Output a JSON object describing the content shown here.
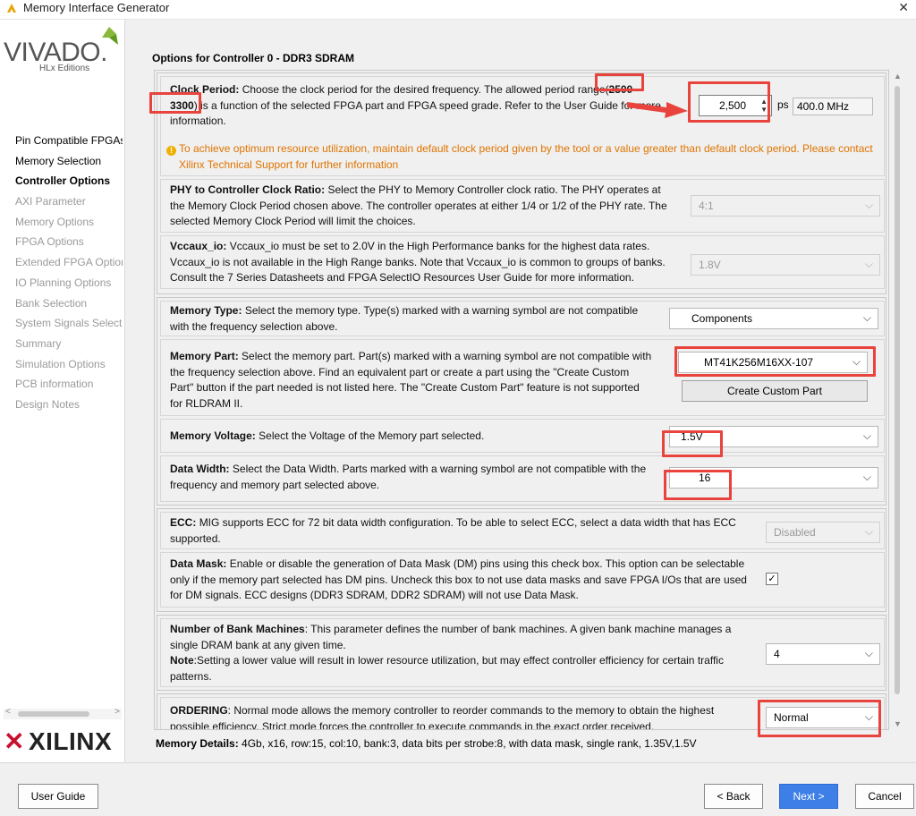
{
  "window": {
    "title": "Memory Interface Generator",
    "close_label": "✕"
  },
  "brand": {
    "vivado": "VIVADO.",
    "hlx": "HLx Editions",
    "xilinx": "XILINX"
  },
  "nav": {
    "items": [
      {
        "label": "Pin Compatible FPGAs",
        "state": "enabled"
      },
      {
        "label": "Memory Selection",
        "state": "enabled"
      },
      {
        "label": "Controller Options",
        "state": "current"
      },
      {
        "label": "AXI Parameter",
        "state": "disabled"
      },
      {
        "label": "Memory Options",
        "state": "disabled"
      },
      {
        "label": "FPGA Options",
        "state": "disabled"
      },
      {
        "label": "Extended FPGA Options",
        "state": "disabled"
      },
      {
        "label": "IO Planning Options",
        "state": "disabled"
      },
      {
        "label": "Bank Selection",
        "state": "disabled"
      },
      {
        "label": "System Signals Selection",
        "state": "disabled"
      },
      {
        "label": "Summary",
        "state": "disabled"
      },
      {
        "label": "Simulation Options",
        "state": "disabled"
      },
      {
        "label": "PCB information",
        "state": "disabled"
      },
      {
        "label": "Design Notes",
        "state": "disabled"
      }
    ]
  },
  "main": {
    "heading": "Options for Controller 0 - DDR3 SDRAM",
    "clock": {
      "title": "Clock Period:",
      "line1": "Choose the clock period for the desired frequency. The allowed period range(",
      "range_a": "2500 -",
      "range_b": "3300",
      "line2": ") is a function of the selected FPGA part and FPGA speed grade. Refer to the User Guide for more",
      "line3": "information.",
      "value": "2,500",
      "unit": "ps",
      "freq": "400.0 MHz",
      "warning_line1": "To achieve optimum resource utilization, maintain default clock period given by the tool or a value greater than default clock period. Please contact",
      "warning_line2": "Xilinx Technical Support for further information"
    },
    "phy": {
      "title": "PHY to Controller Clock Ratio:",
      "line1": "Select the PHY to Memory Controller clock ratio. The PHY operates at",
      "line2": "the Memory Clock Period chosen above. The controller operates at either 1/4 or 1/2 of the PHY rate. The",
      "line3": "selected Memory Clock Period will limit the choices.",
      "value": "4:1"
    },
    "vccaux": {
      "title": "Vccaux_io:",
      "line1": "Vccaux_io must be set to 2.0V in the High Performance banks for the highest data rates.",
      "line2": "Vccaux_io is not available in the High Range banks. Note that Vccaux_io is common to groups of banks.",
      "line3": "Consult the 7 Series Datasheets and FPGA SelectIO Resources User Guide for more information.",
      "value": "1.8V"
    },
    "memtype": {
      "title": "Memory Type:",
      "line1": "Select the memory type. Type(s) marked with a warning symbol are not compatible",
      "line2": "with the frequency selection above.",
      "value": "Components"
    },
    "mempart": {
      "title": "Memory Part:",
      "line1": "Select the memory part. Part(s) marked with a warning symbol are not compatible with",
      "line2": "the frequency selection above. Find an equivalent part or create a part using the \"Create Custom",
      "line3": "Part\" button if the part needed is not listed here. The \"Create Custom Part\" feature is not supported",
      "line4": "for RLDRAM II.",
      "value": "MT41K256M16XX-107",
      "custom_button": "Create Custom Part"
    },
    "voltage": {
      "title": "Memory Voltage:",
      "line1": "Select the Voltage of the Memory part selected.",
      "value": "1.5V"
    },
    "width": {
      "title": "Data Width:",
      "line1": "Select the Data Width. Parts marked with a warning symbol are not compatible with the",
      "line2": "frequency and memory part selected above.",
      "value": "16"
    },
    "ecc": {
      "title": "ECC:",
      "line1": "MIG supports ECC for 72 bit data width configuration. To be able to select ECC, select a data width that has ECC",
      "line2": "supported.",
      "value": "Disabled"
    },
    "datamask": {
      "title": "Data Mask:",
      "line1": "Enable or disable the generation of Data Mask (DM) pins using this check box. This option can be selectable",
      "line2": "only if the memory part selected has DM pins. Uncheck this box to not use data masks and save FPGA I/Os that are used",
      "line3": "for DM signals. ECC designs (DDR3 SDRAM, DDR2 SDRAM) will not use Data Mask.",
      "checked": "✓"
    },
    "bankmach": {
      "title": "Number of Bank Machines",
      "line1": ": This parameter defines the number of bank machines. A given bank machine manages a",
      "line2": "single DRAM bank at any given time.",
      "note_title": "Note",
      "line3": ":Setting a lower value will result in lower resource utilization, but may effect controller efficiency for certain traffic",
      "line4": "patterns.",
      "value": "4"
    },
    "ordering": {
      "title": "ORDERING",
      "line1": ": Normal mode allows the memory controller to reorder commands to the memory to obtain the highest",
      "line2": "possible efficiency. Strict mode forces the controller to execute commands in the exact order received.",
      "value": "Normal"
    },
    "details": {
      "title": "Memory Details:",
      "text": "4Gb, x16, row:15, col:10, bank:3, data bits per strobe:8, with data mask, single rank, 1.35V,1.5V"
    }
  },
  "footer": {
    "user_guide": "User Guide",
    "back": "< Back",
    "next": "Next >",
    "cancel": "Cancel"
  },
  "colors": {
    "accent": "#3d7fe6",
    "highlight": "#e8433c",
    "warning": "#e07400",
    "xilinx_red": "#c8102e"
  }
}
